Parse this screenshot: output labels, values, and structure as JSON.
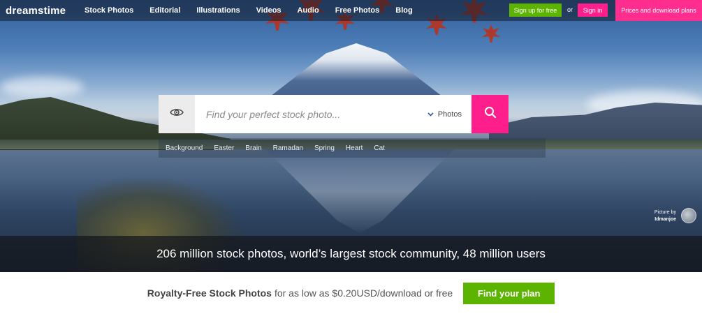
{
  "brand": {
    "logo_text": "dreamstime"
  },
  "nav": {
    "items": [
      "Stock Photos",
      "Editorial",
      "Illustrations",
      "Videos",
      "Audio",
      "Free Photos",
      "Blog"
    ]
  },
  "auth": {
    "signup_label": "Sign up for free",
    "or_label": "or",
    "signin_label": "Sign in",
    "prices_label": "Prices and download plans"
  },
  "search": {
    "placeholder": "Find your perfect stock photo...",
    "type_selected": "Photos",
    "icons": {
      "visual_search": "eye-icon",
      "submit": "search-icon",
      "dropdown": "chevron-down-icon"
    }
  },
  "tags": [
    "Background",
    "Easter",
    "Brain",
    "Ramadan",
    "Spring",
    "Heart",
    "Cat"
  ],
  "credit": {
    "prefix": "Picture by",
    "author": "Idmanjoe"
  },
  "stats": {
    "text": "206 million stock photos, world’s largest stock community, 48 million users"
  },
  "promo": {
    "lead": "Royalty-Free Stock Photos",
    "rest": "for as low as $0.20USD/download or free",
    "button_label": "Find your plan"
  },
  "colors": {
    "accent_pink": "#ff1f8c",
    "accent_green": "#5cb300"
  }
}
